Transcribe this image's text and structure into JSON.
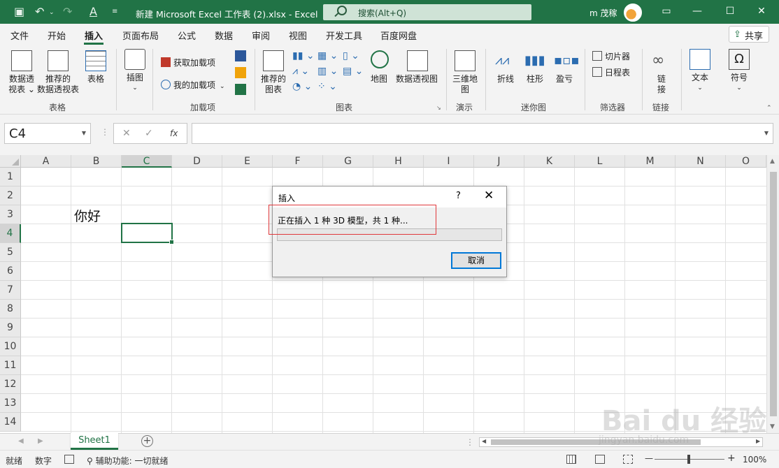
{
  "titlebar": {
    "save_icon": "save-icon",
    "undo_icon": "undo-icon",
    "redo_icon": "redo-icon",
    "font_color_icon": "font-color-icon",
    "title": "新建 Microsoft Excel 工作表 (2).xlsx  -  Excel",
    "search_placeholder": "搜索(Alt+Q)",
    "user": "m 茂稼",
    "minimize": "—",
    "restore": "❐",
    "maximize": "☐",
    "close": "✕",
    "accent": "#217346"
  },
  "menu": {
    "items": [
      "文件",
      "开始",
      "插入",
      "页面布局",
      "公式",
      "数据",
      "审阅",
      "视图",
      "开发工具",
      "百度网盘"
    ],
    "active": "插入",
    "share": "共享"
  },
  "ribbon": {
    "table_group": {
      "label": "表格",
      "pivot": [
        "数据透",
        "视表 ⌄"
      ],
      "rec_pivot": [
        "推荐的",
        "数据透视表"
      ],
      "table": "表格"
    },
    "illustrations_group": {
      "insert_picture": "插图"
    },
    "addins_group": {
      "label": "加载项",
      "get_addins": "获取加载项",
      "my_addins": "我的加载项"
    },
    "charts_group": {
      "label": "图表",
      "recommended": [
        "推荐的",
        "图表"
      ],
      "map": "地图",
      "pivot_chart": "数据透视图"
    },
    "tours_group": {
      "label": "演示",
      "map3d": [
        "三维地",
        "图"
      ]
    },
    "sparklines_group": {
      "label": "迷你图",
      "line": "折线",
      "column": "柱形",
      "winloss": "盈亏"
    },
    "filters_group": {
      "label": "筛选器",
      "slicer": "切片器",
      "timeline": "日程表"
    },
    "links_group": {
      "label": "链接",
      "link": [
        "链",
        "接"
      ]
    },
    "text": "文本",
    "symbols": "符号"
  },
  "formula_bar": {
    "name_box": "C4",
    "cancel": "✕",
    "enter": "✓",
    "fx": "fx",
    "formula": ""
  },
  "grid": {
    "columns": [
      "A",
      "B",
      "C",
      "D",
      "E",
      "F",
      "G",
      "H",
      "I",
      "J",
      "K",
      "L",
      "M",
      "N",
      "O"
    ],
    "rows": [
      "1",
      "2",
      "3",
      "4",
      "5",
      "6",
      "7",
      "8",
      "9",
      "10",
      "11",
      "12",
      "13",
      "14"
    ],
    "selected_column": "C",
    "selected_row": "4",
    "cell_b3": "你好"
  },
  "dialog": {
    "title": "插入",
    "help": "?",
    "close": "✕",
    "message": "正在插入 1 种 3D 模型，共 1 种...",
    "cancel": "取消"
  },
  "sheets": {
    "tabs": [
      "Sheet1"
    ],
    "add": "+"
  },
  "statusbar": {
    "ready": "就绪",
    "num": "数字",
    "accessibility": "辅助功能: 一切就绪",
    "zoom": "100%",
    "zoom_out": "—",
    "zoom_in": "+"
  },
  "watermark": {
    "text": "Bai du 经验",
    "url": "jingyan.baidu.com"
  }
}
